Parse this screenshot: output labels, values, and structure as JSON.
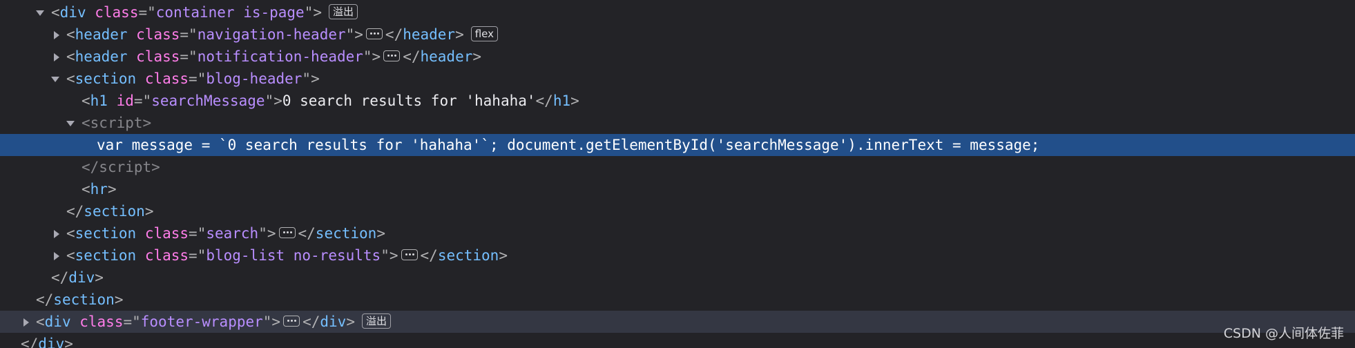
{
  "rows": [
    {
      "tag": "div",
      "attr": "class",
      "value": "container is-page",
      "badge": "溢出"
    },
    {
      "tag": "header",
      "attr": "class",
      "value": "navigation-header",
      "badge": "flex"
    },
    {
      "tag": "header",
      "attr": "class",
      "value": "notification-header"
    },
    {
      "tag": "section",
      "attr": "class",
      "value": "blog-header"
    },
    {
      "tag": "h1",
      "attr": "id",
      "value": "searchMessage",
      "text": "0 search results for 'hahaha'"
    },
    {
      "tag": "script"
    },
    {
      "text": "var message = `0 search results for 'hahaha'`; document.getElementById('searchMessage').innerText = message;"
    },
    {
      "tag": "script"
    },
    {
      "tag": "hr"
    },
    {
      "tag": "section"
    },
    {
      "tag": "section",
      "attr": "class",
      "value": "search"
    },
    {
      "tag": "section",
      "attr": "class",
      "value": "blog-list no-results"
    },
    {
      "tag": "div"
    },
    {
      "tag": "section"
    },
    {
      "tag": "div",
      "attr": "class",
      "value": "footer-wrapper",
      "badge": "溢出"
    },
    {
      "tag": "div"
    }
  ],
  "watermark": "CSDN @人间体佐菲",
  "colors": {
    "background": "#232327",
    "selection": "#224f8a",
    "hover_row": "#343743",
    "tag": "#75bfff",
    "attribute_name": "#ff7de9",
    "attribute_value": "#b98eff"
  },
  "icons": [
    "disclosure-open-icon",
    "disclosure-closed-icon",
    "collapsed-content-icon"
  ]
}
